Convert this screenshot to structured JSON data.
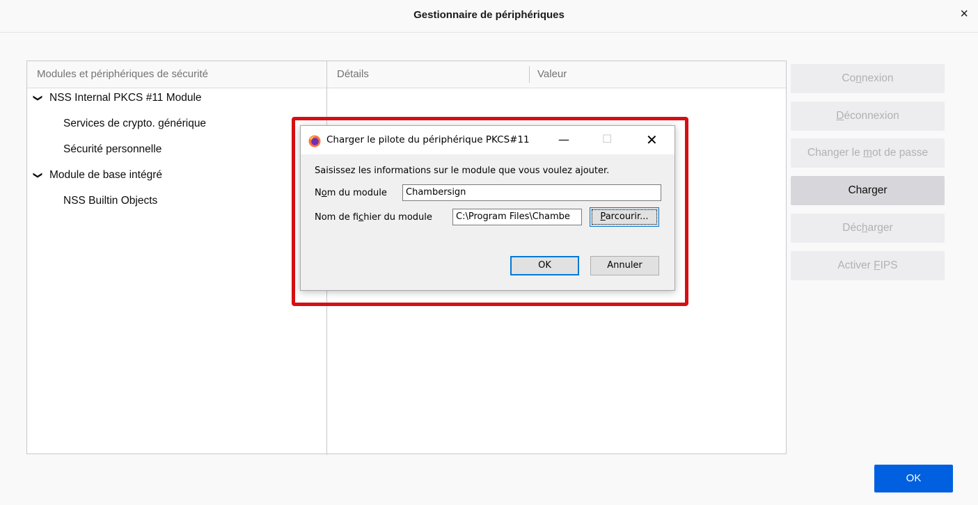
{
  "window": {
    "title": "Gestionnaire de périphériques",
    "close_glyph": "×"
  },
  "tree": {
    "headers": [
      "Modules et périphériques de sécurité",
      "Détails",
      "Valeur"
    ],
    "rows": [
      {
        "label": "NSS Internal PKCS #11 Module",
        "expanded": true,
        "level": 0
      },
      {
        "label": "Services de crypto. générique",
        "level": 1
      },
      {
        "label": "Sécurité personnelle",
        "level": 1
      },
      {
        "label": "Module de base intégré",
        "expanded": true,
        "level": 0
      },
      {
        "label": "NSS Builtin Objects",
        "level": 1
      }
    ]
  },
  "side_buttons": [
    {
      "pre": "Co",
      "accel": "n",
      "post": "nexion",
      "enabled": false
    },
    {
      "pre": "",
      "accel": "D",
      "post": "éconnexion",
      "enabled": false
    },
    {
      "pre": "Changer le ",
      "accel": "m",
      "post": "ot de passe",
      "enabled": false
    },
    {
      "pre": "Char",
      "accel": "g",
      "post": "er",
      "enabled": true
    },
    {
      "pre": "Déc",
      "accel": "h",
      "post": "arger",
      "enabled": false
    },
    {
      "pre": "Activer ",
      "accel": "F",
      "post": "IPS",
      "enabled": false
    }
  ],
  "ok_label": "OK",
  "dialog": {
    "title": "Charger le pilote du périphérique PKCS#11",
    "description": "Saisissez les informations sur le module que vous voulez ajouter.",
    "name_label_pre": "N",
    "name_label_accel": "o",
    "name_label_post": "m du module",
    "name_value": "Chambersign",
    "file_label_pre": "Nom de fi",
    "file_label_accel": "c",
    "file_label_post": "hier du module",
    "file_value": "C:\\Program Files\\Chambe",
    "browse_accel": "P",
    "browse_post": "arcourir...",
    "ok_label": "OK",
    "cancel_label": "Annuler",
    "highlight_color": "#d50f13"
  }
}
